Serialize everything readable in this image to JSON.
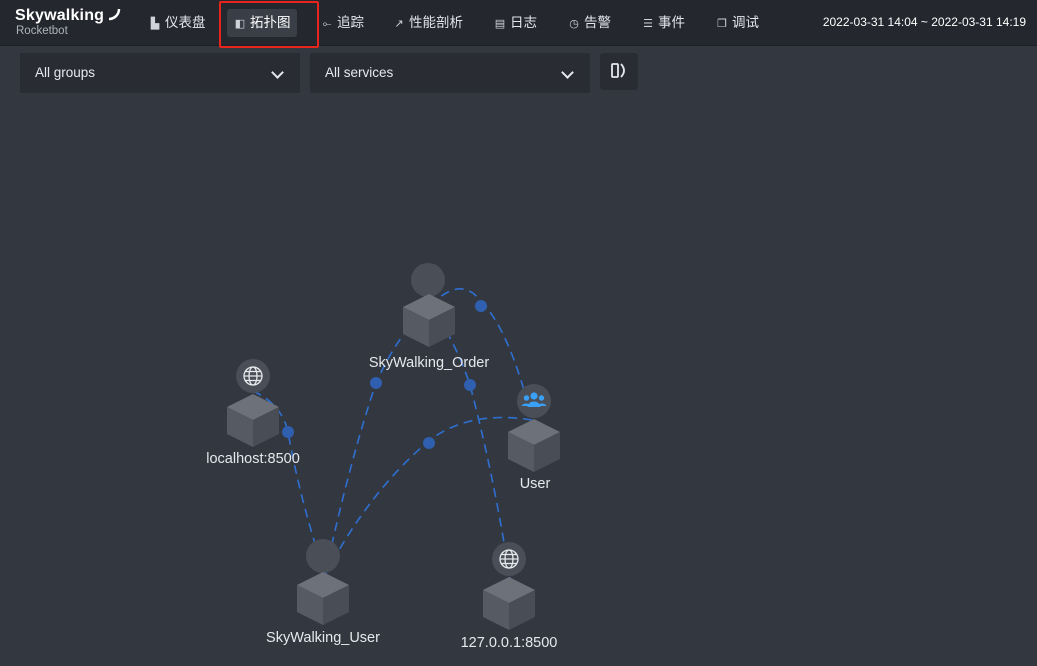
{
  "app": {
    "title": "Skywalking",
    "subtitle": "Rocketbot"
  },
  "nav": [
    {
      "label": "仪表盘",
      "icon": "dashboard-icon"
    },
    {
      "label": "拓扑图",
      "icon": "topology-icon",
      "active": true
    },
    {
      "label": "追踪",
      "icon": "trace-icon"
    },
    {
      "label": "性能剖析",
      "icon": "profile-icon"
    },
    {
      "label": "日志",
      "icon": "log-icon"
    },
    {
      "label": "告警",
      "icon": "alarm-icon"
    },
    {
      "label": "事件",
      "icon": "event-icon"
    },
    {
      "label": "调试",
      "icon": "debug-icon"
    }
  ],
  "time_range": "2022-03-31 14:04 ~ 2022-03-31 14:19",
  "filters": {
    "group": "All groups",
    "service": "All services"
  },
  "colors": {
    "accent": "#2f6fd1",
    "highlight": "#e8251d",
    "background": "#333840"
  },
  "topology": {
    "nodes": [
      {
        "id": "order",
        "label": "SkyWalking_Order",
        "type": "service"
      },
      {
        "id": "localhost",
        "label": "localhost:8500",
        "type": "http",
        "icon": "globe-icon"
      },
      {
        "id": "user",
        "label": "User",
        "type": "user",
        "icon": "users-icon"
      },
      {
        "id": "swuser",
        "label": "SkyWalking_User",
        "type": "service"
      },
      {
        "id": "ip",
        "label": "127.0.0.1:8500",
        "type": "http",
        "icon": "globe-icon"
      }
    ],
    "edges": [
      {
        "from": "user",
        "to": "order"
      },
      {
        "from": "user",
        "to": "swuser"
      },
      {
        "from": "swuser",
        "to": "order"
      },
      {
        "from": "swuser",
        "to": "localhost"
      },
      {
        "from": "order",
        "to": "ip"
      }
    ]
  }
}
